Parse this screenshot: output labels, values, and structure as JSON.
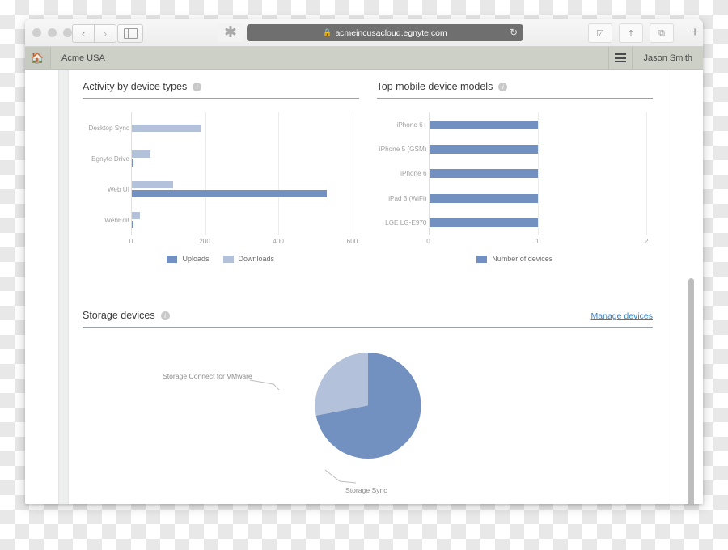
{
  "browser": {
    "url": "acmeincusacloud.egnyte.com",
    "lock_icon": "lock-icon",
    "reload_icon": "reload-icon",
    "back_icon": "‹",
    "forward_icon": "›",
    "sidebar_icon": "sidebar-toggle-icon",
    "snow_icon": "✱",
    "bookmark_icon": "⬇",
    "share_icon": "⤴",
    "tabs_icon": "⧉",
    "new_tab_icon": "+"
  },
  "appheader": {
    "home_icon": "🏠",
    "org_name": "Acme USA",
    "menu_icon": "hamburger-menu-icon",
    "user_name": "Jason Smith"
  },
  "widgets": {
    "activity": {
      "title": "Activity by device types",
      "info_icon": "i"
    },
    "mobile": {
      "title": "Top mobile device models",
      "info_icon": "i"
    },
    "storage": {
      "title": "Storage devices",
      "info_icon": "i",
      "manage_link": "Manage devices"
    }
  },
  "chart_data": [
    {
      "type": "bar",
      "orientation": "horizontal",
      "title": "Activity by device types",
      "categories": [
        "Desktop Sync",
        "Egnyte Drive",
        "Web UI",
        "WebEdit"
      ],
      "series": [
        {
          "name": "Uploads",
          "color": "#7290c0",
          "values": [
            0,
            5,
            530,
            5
          ]
        },
        {
          "name": "Downloads",
          "color": "#b3c2da",
          "values": [
            188,
            50,
            113,
            22
          ]
        }
      ],
      "xlabel": "",
      "ylabel": "",
      "xlim": [
        0,
        600
      ],
      "xticks": [
        0,
        200,
        400,
        600
      ],
      "grid": true,
      "legend": "bottom-center"
    },
    {
      "type": "bar",
      "orientation": "horizontal",
      "title": "Top mobile device models",
      "categories": [
        "iPhone 6+",
        "iPhone 5 (GSM)",
        "iPhone 6",
        "iPad 3 (WiFi)",
        "LGE LG-E970"
      ],
      "series": [
        {
          "name": "Number of devices",
          "color": "#7290c0",
          "values": [
            1,
            1,
            1,
            1,
            1
          ]
        }
      ],
      "xlabel": "",
      "ylabel": "",
      "xlim": [
        0,
        2
      ],
      "xticks": [
        0,
        1,
        2
      ],
      "grid": true,
      "legend": "bottom-center"
    },
    {
      "type": "pie",
      "title": "Storage devices",
      "labels": [
        "Storage Sync",
        "Storage Connect for VMware"
      ],
      "values": [
        72,
        28
      ],
      "colors": [
        "#7290c0",
        "#b3c2da"
      ],
      "start_angle": 0,
      "legend": "annotations"
    }
  ]
}
